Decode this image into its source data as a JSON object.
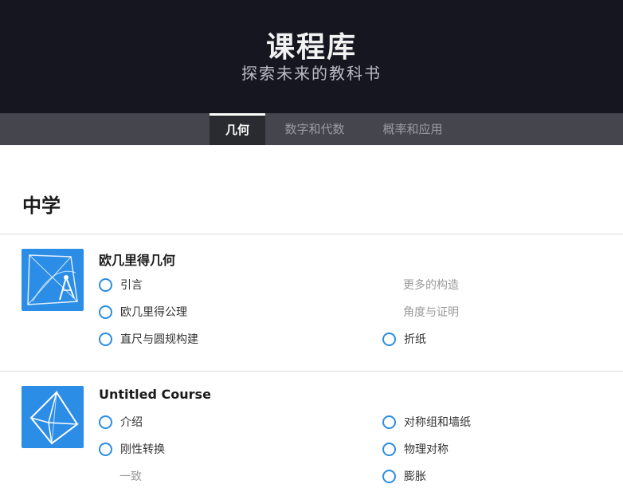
{
  "header": {
    "title": "课程库",
    "subtitle": "探索未来的教科书"
  },
  "tabs": [
    {
      "label": "几何",
      "active": true
    },
    {
      "label": "数字和代数",
      "active": false
    },
    {
      "label": "概率和应用",
      "active": false
    }
  ],
  "section": {
    "heading": "中学"
  },
  "courses": [
    {
      "title": "欧几里得几何",
      "icon": "compass-geometry-icon",
      "lessons_left": [
        {
          "label": "引言",
          "has_ring": true
        },
        {
          "label": "欧几里得公理",
          "has_ring": true
        },
        {
          "label": "直尺与圆规构建",
          "has_ring": true
        }
      ],
      "lessons_right": [
        {
          "label": "更多的构造",
          "has_ring": false
        },
        {
          "label": "角度与证明",
          "has_ring": false
        },
        {
          "label": "折纸",
          "has_ring": true
        }
      ]
    },
    {
      "title": "Untitled Course",
      "icon": "triangle-transform-icon",
      "lessons_left": [
        {
          "label": "介绍",
          "has_ring": true
        },
        {
          "label": "刚性转换",
          "has_ring": true
        },
        {
          "label": "一致",
          "has_ring": false
        }
      ],
      "lessons_right": [
        {
          "label": "对称组和墙纸",
          "has_ring": true
        },
        {
          "label": "物理对称",
          "has_ring": true
        },
        {
          "label": "膨胀",
          "has_ring": true
        }
      ]
    }
  ],
  "colors": {
    "header_bg": "#15161f",
    "tabbar_bg": "#45464d",
    "accent": "#2b8de6"
  }
}
